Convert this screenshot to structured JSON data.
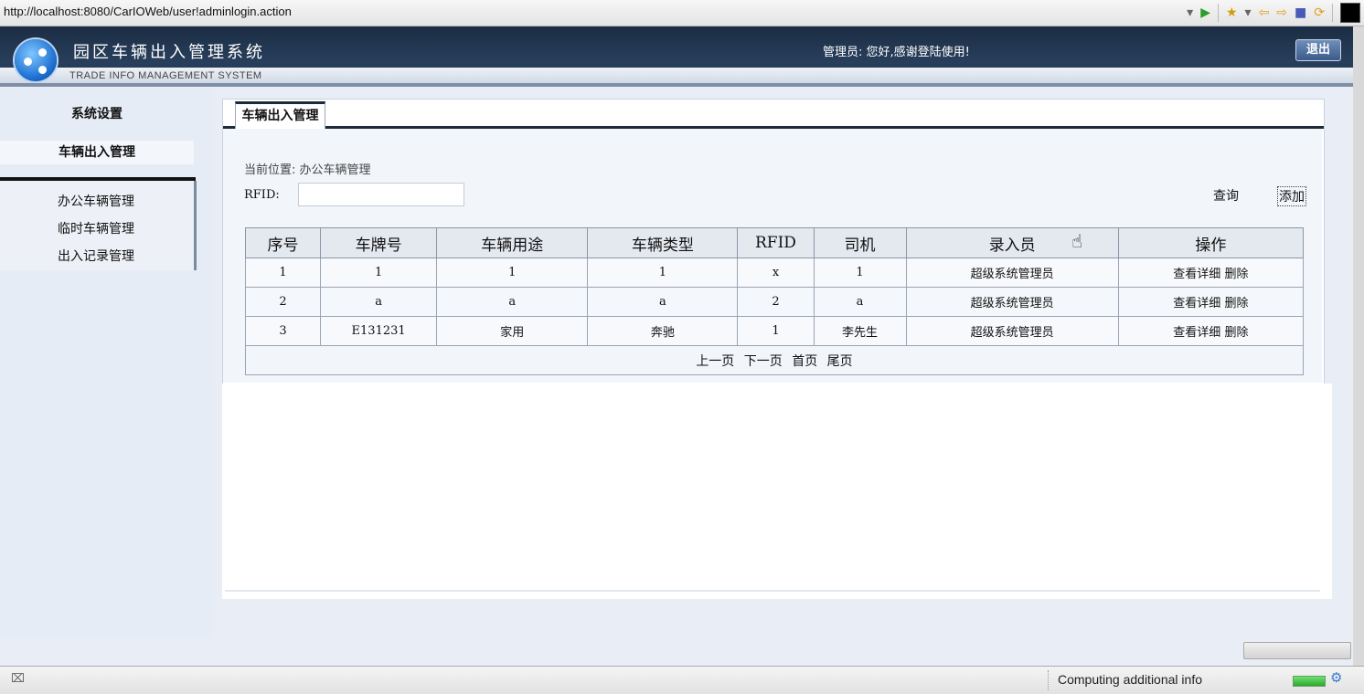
{
  "browser": {
    "url": "http://localhost:8080/CarIOWeb/user!adminlogin.action",
    "status_text": "Computing additional info"
  },
  "header": {
    "title": "园区车辆出入管理系统",
    "subtitle": "TRADE INFO MANAGEMENT SYSTEM",
    "welcome": "管理员:  您好,感谢登陆使用!",
    "logout_label": "退出"
  },
  "sidebar": {
    "section1": "系统设置",
    "section2": "车辆出入管理",
    "items": [
      {
        "label": "办公车辆管理"
      },
      {
        "label": "临时车辆管理"
      },
      {
        "label": "出入记录管理"
      }
    ]
  },
  "main": {
    "tab_label": "车辆出入管理",
    "breadcrumb": "当前位置:  办公车辆管理",
    "rfid_label": "RFID:",
    "query_label": "查询",
    "add_label": "添加",
    "table": {
      "headers": [
        "序号",
        "车牌号",
        "车辆用途",
        "车辆类型",
        "RFID",
        "司机",
        "录入员",
        "操作"
      ],
      "rows": [
        {
          "no": "1",
          "plate": "1",
          "usage": "1",
          "type": "1",
          "rfid": "x",
          "driver": "1",
          "recorder": "超级系统管理员",
          "view": "查看详细",
          "delete": "删除"
        },
        {
          "no": "2",
          "plate": "a",
          "usage": "a",
          "type": "a",
          "rfid": "2",
          "driver": "a",
          "recorder": "超级系统管理员",
          "view": "查看详细",
          "delete": "删除"
        },
        {
          "no": "3",
          "plate": "E131231",
          "usage": "家用",
          "type": "奔驰",
          "rfid": "1",
          "driver": "李先生",
          "recorder": "超级系统管理员",
          "view": "查看详细",
          "delete": "删除"
        }
      ],
      "pager": {
        "prev": "上一页",
        "next": "下一页",
        "first": "首页",
        "last": "尾页"
      }
    }
  },
  "icons": {
    "go": "play-icon",
    "bookmark": "star-icon",
    "back": "arrow-left-icon",
    "forward": "arrow-right-icon",
    "stop": "stop-icon",
    "refresh": "refresh-icon",
    "cursor": "hand-cursor-icon"
  }
}
